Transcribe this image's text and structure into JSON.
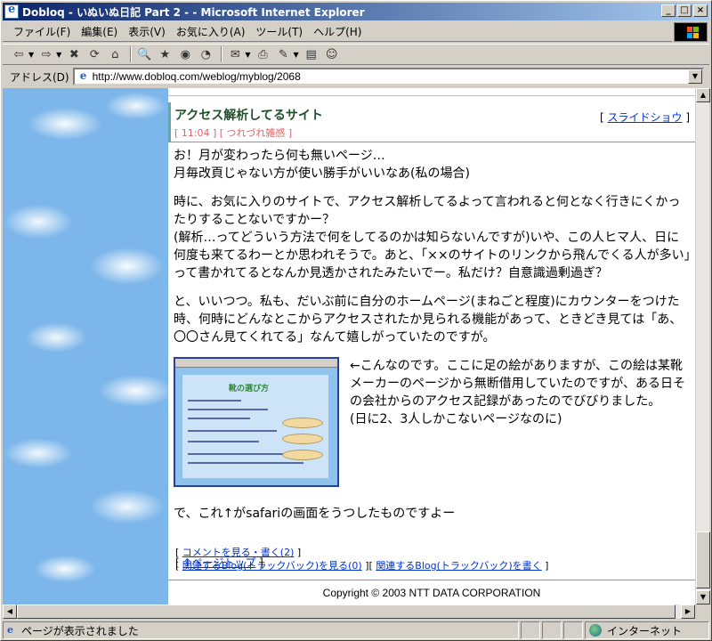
{
  "window": {
    "title": "Dobloq - いぬいぬ日記 Part 2 - - Microsoft Internet Explorer",
    "min_glyph": "_",
    "max_glyph": "□",
    "close_glyph": "×"
  },
  "menu": [
    "ファイル(F)",
    "編集(E)",
    "表示(V)",
    "お気に入り(A)",
    "ツール(T)",
    "ヘルプ(H)"
  ],
  "toolbar": {
    "icons": [
      "back-icon",
      "forward-icon",
      "stop-icon",
      "refresh-icon",
      "home-icon",
      "search-icon",
      "favorites-icon",
      "media-icon",
      "history-icon",
      "mail-icon",
      "print-icon",
      "edit-icon",
      "discuss-icon",
      "messenger-icon"
    ],
    "glyphs": [
      "⇦",
      "⇨",
      "✖",
      "⟳",
      "⌂",
      "🔍",
      "★",
      "◉",
      "◔",
      "✉",
      "⎙",
      "✎",
      "▤",
      "☺"
    ]
  },
  "address": {
    "label": "アドレス(D)",
    "url": "http://www.dobloq.com/weblog/myblog/2068"
  },
  "entry": {
    "title": "アクセス解析してるサイト",
    "meta": "[ 11:04 ] [ つれづれ雑感 ]",
    "slideshow": "スライドショウ",
    "paragraphs": [
      "お！月が変わったら何も無いページ…\n月毎改頁じゃない方が使い勝手がいいなあ(私の場合)",
      "時に、お気に入りのサイトで、アクセス解析してるよって言われると何となく行きにくかったりすることないですかー？\n(解析…ってどういう方法で何をしてるのかは知らないんですが)いや、この人ヒマ人、日に何度も来てるわーとか思われそうで。あと、「××のサイトのリンクから飛んでくる人が多い」って書かれてるとなんか見透かされたみたいでー。私だけ？自意識過剰過ぎ？",
      "と、いいつつ。私も、だいぶ前に自分のホームページ(まねごと程度)にカウンターをつけた時、何時にどんなとこからアクセスされたか見られる機能があって、ときどき見ては「あ、〇〇さん見てくれてる」なんて嬉しがっていたのですが。"
    ],
    "image_caption": "←こんなのです。ここに足の絵がありますが、この絵は某靴メーカーのページから無断借用していたのですが、ある日その会社からのアクセス記録があったのでびびりました。\n(日に2、3人しかこないページなのに)",
    "thumb_title": "靴の選び方",
    "after_image": "で、これ↑がsafariの画面をうつしたものですよー"
  },
  "links": {
    "comments": "コメントを見る・書く(2)",
    "trackback_view": "関連するBlog(トラックバック)を見る(0)",
    "trackback_write": "関連するBlog(トラックバック)を書く",
    "pagetop": "↑ページトップ"
  },
  "footer": {
    "copyright": "Copyright © 2003 NTT DATA CORPORATION"
  },
  "status": {
    "message": "ページが表示されました",
    "zone": "インターネット"
  }
}
